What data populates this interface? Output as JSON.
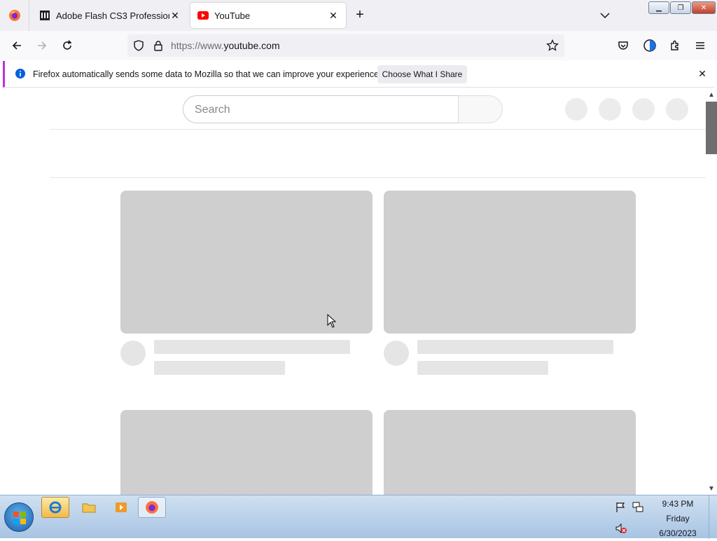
{
  "browser": {
    "tabs": [
      {
        "title": "Adobe Flash CS3 Professional - ",
        "active": false,
        "icon": "museum-icon"
      },
      {
        "title": "YouTube",
        "active": true,
        "icon": "youtube-icon"
      }
    ],
    "url_prefix": "https://www.",
    "url_domain": "youtube.com"
  },
  "notification": {
    "message": "Firefox automatically sends some data to Mozilla so that we can improve your experience.",
    "button": "Choose What I Share"
  },
  "page": {
    "search_placeholder": "Search"
  },
  "taskbar": {
    "time": "9:43 PM",
    "day": "Friday",
    "date": "6/30/2023"
  },
  "colors": {
    "accent": "#b833e1",
    "skeleton_thumb": "#cfcfcf",
    "skeleton_line": "#e5e5e5",
    "firefox_orange": "#ff7139",
    "youtube_red": "#ff0000"
  }
}
